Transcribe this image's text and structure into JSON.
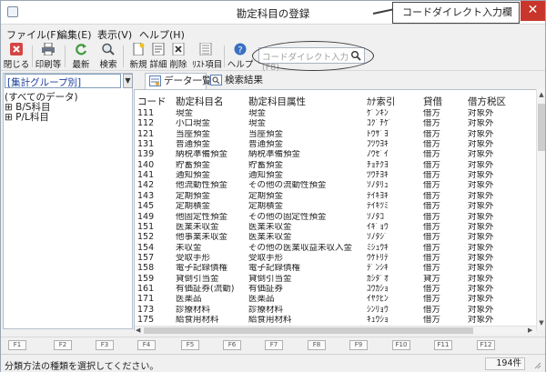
{
  "window": {
    "title": "勘定科目の登録",
    "close_glyph": "✕"
  },
  "callout": {
    "text": "コードダイレクト入力欄"
  },
  "menu": [
    {
      "label": "ファイル(F)"
    },
    {
      "label": "編集(E)"
    },
    {
      "label": "表示(V)"
    },
    {
      "label": "ヘルプ(H)"
    }
  ],
  "toolbar": {
    "buttons": [
      {
        "label": "閉じる",
        "icon": "close-icon"
      },
      {
        "label": "印刷等",
        "icon": "print-icon"
      },
      {
        "label": "最新",
        "icon": "refresh-icon"
      },
      {
        "label": "検索",
        "icon": "search-icon"
      },
      {
        "label": "新規",
        "icon": "new-icon"
      },
      {
        "label": "詳細",
        "icon": "detail-icon"
      },
      {
        "label": "削除",
        "icon": "delete-icon"
      },
      {
        "label": "ﾘｽﾄ項目",
        "icon": "list-items-icon"
      },
      {
        "label": "ヘルプ",
        "icon": "help-icon"
      }
    ],
    "search_placeholder": "コードダイレクト入力(F8)"
  },
  "left_pane": {
    "group_selected": "[集計グループ別]",
    "tree": [
      {
        "label": "(すべてのデータ)"
      },
      {
        "label": "⊞ B/S科目"
      },
      {
        "label": "⊞ P/L科目"
      }
    ]
  },
  "tabs": [
    {
      "label": "データ一覧",
      "icon": "data-list-icon"
    },
    {
      "label": "検索結果",
      "icon": "search-results-icon"
    }
  ],
  "table": {
    "columns": [
      "コード",
      "勘定科目名",
      "勘定科目属性",
      "ｶﾅ索引",
      "貸借",
      "借方税区"
    ],
    "rows": [
      {
        "code": "111",
        "name": "現金",
        "attr": "現金",
        "kana": "ｹﾞﾝｷﾝ",
        "dc": "借方",
        "tax": "対象外"
      },
      {
        "code": "112",
        "name": "小口現金",
        "attr": "現金",
        "kana": "ｺｸﾞﾁｹﾞ",
        "dc": "借方",
        "tax": "対象外"
      },
      {
        "code": "121",
        "name": "当座預金",
        "attr": "当座預金",
        "kana": "ﾄｳｻﾞﾖ",
        "dc": "借方",
        "tax": "対象外"
      },
      {
        "code": "131",
        "name": "普通預金",
        "attr": "普通預金",
        "kana": "ﾌﾂｳﾖｷ",
        "dc": "借方",
        "tax": "対象外"
      },
      {
        "code": "139",
        "name": "納税準備預金",
        "attr": "納税準備預金",
        "kana": "ﾉｳｾﾞｲ",
        "dc": "借方",
        "tax": "対象外"
      },
      {
        "code": "140",
        "name": "貯蓄預金",
        "attr": "貯蓄預金",
        "kana": "ﾁｮﾁｸﾖ",
        "dc": "借方",
        "tax": "対象外"
      },
      {
        "code": "141",
        "name": "通知預金",
        "attr": "通知預金",
        "kana": "ﾂｳﾁﾖｷ",
        "dc": "借方",
        "tax": "対象外"
      },
      {
        "code": "142",
        "name": "他流動性預金",
        "attr": "その他の流動性預金",
        "kana": "ｿﾉﾀﾘｭ",
        "dc": "借方",
        "tax": "対象外"
      },
      {
        "code": "143",
        "name": "定期預金",
        "attr": "定期預金",
        "kana": "ﾃｲｷﾖｷ",
        "dc": "借方",
        "tax": "対象外"
      },
      {
        "code": "145",
        "name": "定期積金",
        "attr": "定期積金",
        "kana": "ﾃｲｷﾂﾐ",
        "dc": "借方",
        "tax": "対象外"
      },
      {
        "code": "149",
        "name": "他固定性預金",
        "attr": "その他の固定性預金",
        "kana": "ｿﾉﾀｺ",
        "dc": "借方",
        "tax": "対象外"
      },
      {
        "code": "151",
        "name": "医業未収金",
        "attr": "医業未収金",
        "kana": "ｲｷﾞｮｳ",
        "dc": "借方",
        "tax": "対象外"
      },
      {
        "code": "152",
        "name": "他事業未収金",
        "attr": "医業未収金",
        "kana": "ｿﾉﾀｼﾞ",
        "dc": "借方",
        "tax": "対象外"
      },
      {
        "code": "154",
        "name": "未収金",
        "attr": "その他の医業収益未収入金",
        "kana": "ﾐｼｭｳｷ",
        "dc": "借方",
        "tax": "対象外"
      },
      {
        "code": "157",
        "name": "受取手形",
        "attr": "受取手形",
        "kana": "ｳｹﾄﾘﾃ",
        "dc": "借方",
        "tax": "対象外"
      },
      {
        "code": "158",
        "name": "電子記録債権",
        "attr": "電子記録債権",
        "kana": "ﾃﾞﾝｼｷ",
        "dc": "借方",
        "tax": "対象外"
      },
      {
        "code": "159",
        "name": "貸倒引当金",
        "attr": "貸倒引当金",
        "kana": "ｶｼﾀﾞｵ",
        "dc": "貸方",
        "tax": "対象外"
      },
      {
        "code": "161",
        "name": "有価証券(流動)",
        "attr": "有価証券",
        "kana": "ﾕｳｶｼｮ",
        "dc": "借方",
        "tax": "対象外"
      },
      {
        "code": "171",
        "name": "医薬品",
        "attr": "医薬品",
        "kana": "ｲﾔｸﾋﾝ",
        "dc": "借方",
        "tax": "対象外"
      },
      {
        "code": "173",
        "name": "診療材料",
        "attr": "診療材料",
        "kana": "ｼﾝﾘｮｳ",
        "dc": "借方",
        "tax": "対象外"
      },
      {
        "code": "175",
        "name": "給食用材料",
        "attr": "給食用材料",
        "kana": "ｷｭｳｼｮ",
        "dc": "借方",
        "tax": "対象外"
      }
    ]
  },
  "fkeys": [
    "F1",
    "F2",
    "F3",
    "F4",
    "F5",
    "F6",
    "F7",
    "F8",
    "F9",
    "F10",
    "F11",
    "F12"
  ],
  "status": {
    "message": "分類方法の種類を選択してください。",
    "count": "194件"
  },
  "colors": {
    "accent": "#1a3f9e",
    "close": "#c8352b"
  }
}
